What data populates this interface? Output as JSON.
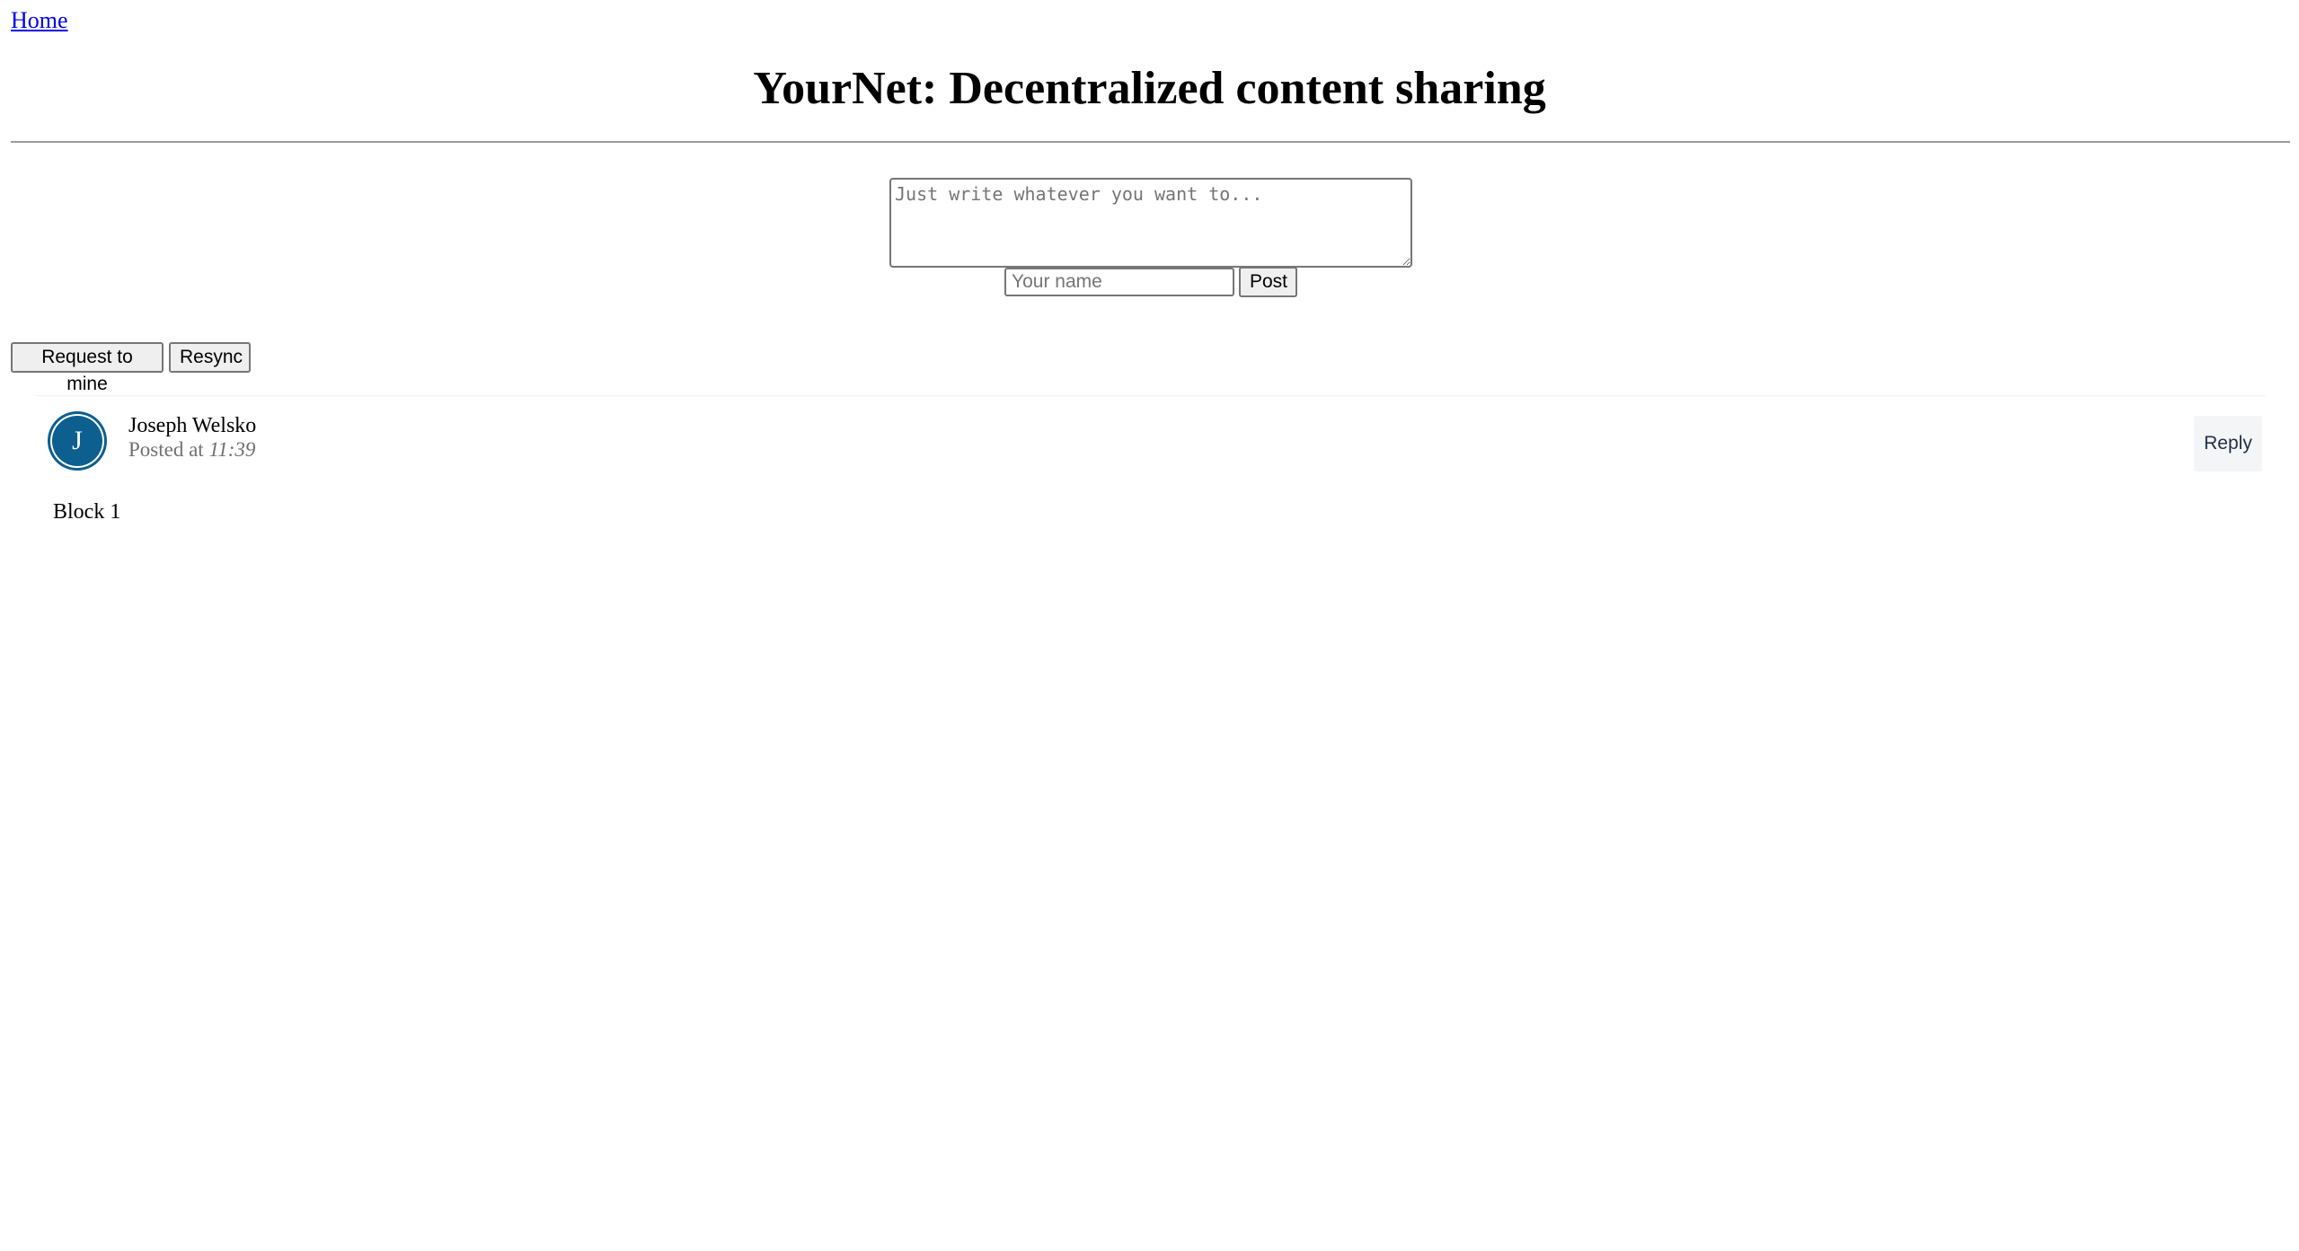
{
  "nav": {
    "home_label": "Home"
  },
  "header": {
    "title": "YourNet: Decentralized content sharing"
  },
  "composer": {
    "textarea_placeholder": "Just write whatever you want to...",
    "textarea_value": "",
    "name_placeholder": "Your name",
    "name_value": "",
    "post_label": "Post"
  },
  "actions": {
    "request_to_mine_label": "Request to mine",
    "resync_label": "Resync"
  },
  "posts": [
    {
      "avatar_initial": "J",
      "avatar_color": "#0c5f8f",
      "author": "Joseph Welsko",
      "posted_prefix": "Posted at",
      "posted_time": "11:39",
      "body": "Block 1",
      "reply_label": "Reply"
    }
  ]
}
